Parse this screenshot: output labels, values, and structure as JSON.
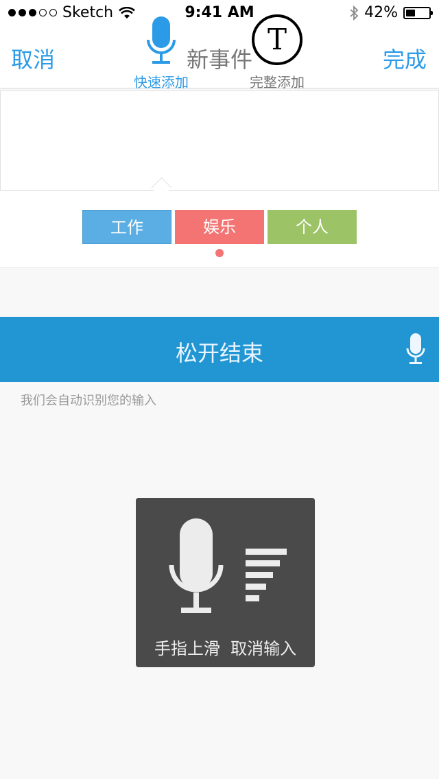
{
  "status_bar": {
    "carrier": "Sketch",
    "time": "9:41 AM",
    "battery_text": "42%",
    "battery_level": 0.42
  },
  "nav": {
    "cancel": "取消",
    "title": "新事件",
    "done": "完成"
  },
  "modes": {
    "quick_label": "快速添加",
    "full_label": "完整添加",
    "full_icon_letter": "T"
  },
  "categories": {
    "work": "工作",
    "fun": "娱乐",
    "personal": "个人"
  },
  "voice": {
    "bar_text": "松开结束",
    "hint": "我们会自动识别您的输入",
    "overlay_text": "手指上滑  取消输入"
  },
  "colors": {
    "accent": "#2b9be8",
    "voice_bar": "#2295d3",
    "work": "#5aaee3",
    "fun": "#f47474",
    "personal": "#9cc466"
  }
}
